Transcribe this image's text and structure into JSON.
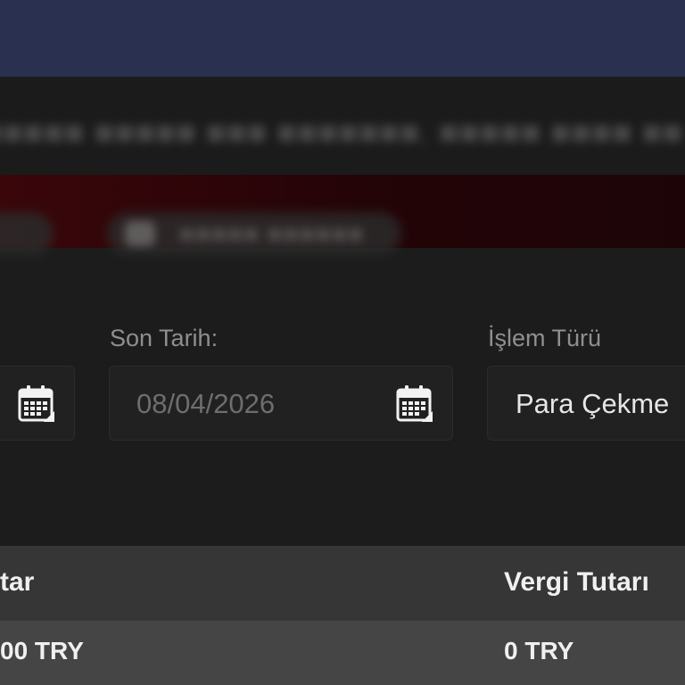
{
  "filters": {
    "end_date_label": "Son Tarih:",
    "end_date_value": "08/04/2026",
    "transaction_type_label": "İşlem Türü",
    "transaction_type_value": "Para Çekme"
  },
  "table": {
    "headers": [
      "tar",
      "Vergi Tutarı"
    ],
    "rows": [
      [
        "00 TRY",
        "0 TRY"
      ]
    ]
  },
  "icons": {
    "calendar": "calendar-icon"
  },
  "colors": {
    "header_bar": "#2a3150",
    "background": "#1c1c1c",
    "alert_band": "#3a060a",
    "table_header": "#363636",
    "table_row": "#454545"
  }
}
